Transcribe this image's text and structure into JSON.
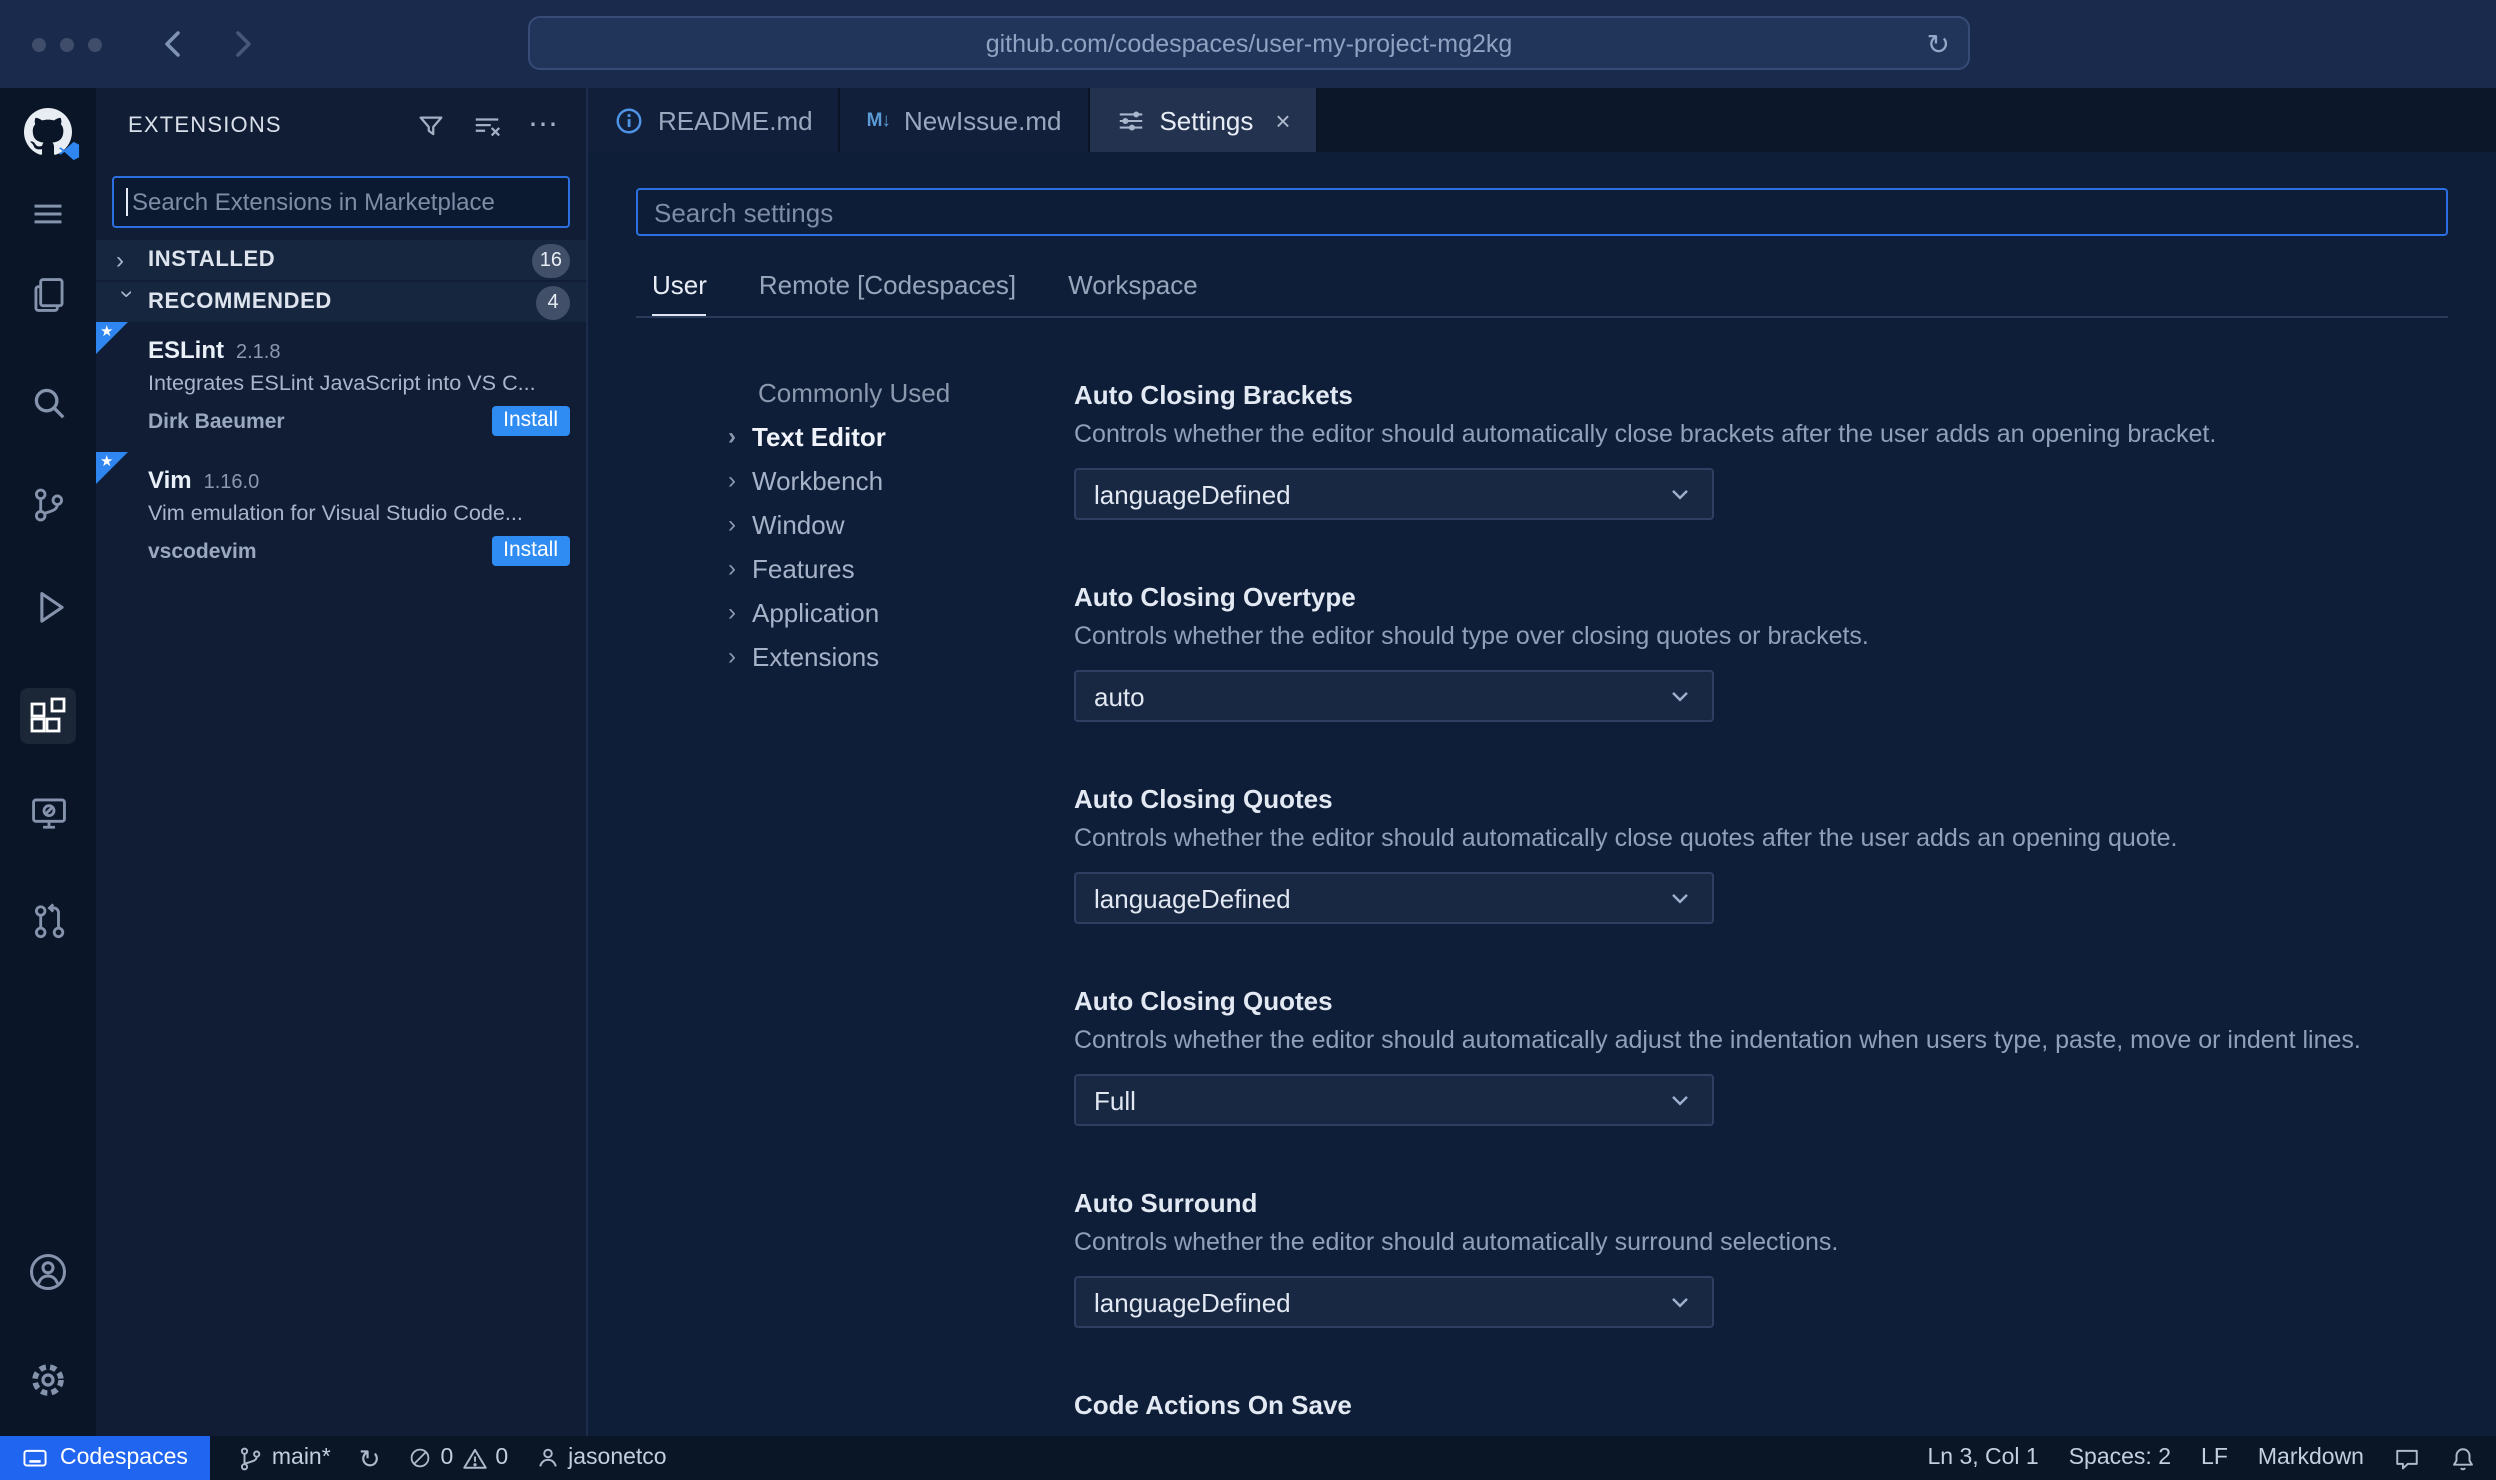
{
  "browser": {
    "url": "github.com/codespaces/user-my-project-mg2kg"
  },
  "sidebar": {
    "title": "EXTENSIONS",
    "search": {
      "placeholder": "Search Extensions in Marketplace"
    },
    "sections": [
      {
        "label": "INSTALLED",
        "badge": "16",
        "expanded": false
      },
      {
        "label": "RECOMMENDED",
        "badge": "4",
        "expanded": true
      }
    ],
    "extensions": [
      {
        "name": "ESLint",
        "version": "2.1.8",
        "description": "Integrates ESLint JavaScript into VS C...",
        "author": "Dirk Baeumer",
        "action_label": "Install"
      },
      {
        "name": "Vim",
        "version": "1.16.0",
        "description": "Vim emulation for Visual Studio Code...",
        "author": "vscodevim",
        "action_label": "Install"
      }
    ]
  },
  "editor": {
    "tabs": [
      {
        "label": "README.md",
        "icon": "info-icon",
        "active": false
      },
      {
        "label": "NewIssue.md",
        "icon": "markdown-icon",
        "active": false
      },
      {
        "label": "Settings",
        "icon": "sliders-icon",
        "active": true,
        "closable": true
      }
    ]
  },
  "settings_page": {
    "search": {
      "placeholder": "Search settings"
    },
    "scopes": [
      {
        "label": "User",
        "active": true
      },
      {
        "label": "Remote [Codespaces]",
        "active": false
      },
      {
        "label": "Workspace",
        "active": false
      }
    ],
    "toc": [
      {
        "label": "Commonly Used",
        "chevron": false,
        "active": false
      },
      {
        "label": "Text Editor",
        "chevron": true,
        "active": true
      },
      {
        "label": "Workbench",
        "chevron": true,
        "active": false
      },
      {
        "label": "Window",
        "chevron": true,
        "active": false
      },
      {
        "label": "Features",
        "chevron": true,
        "active": false
      },
      {
        "label": "Application",
        "chevron": true,
        "active": false
      },
      {
        "label": "Extensions",
        "chevron": true,
        "active": false
      }
    ],
    "items": [
      {
        "title": "Auto Closing Brackets",
        "description": "Controls whether the editor should automatically close brackets after the user adds an opening bracket.",
        "value": "languageDefined",
        "control": "select"
      },
      {
        "title": "Auto Closing Overtype",
        "description": "Controls whether the editor should type over closing quotes or brackets.",
        "value": "auto",
        "control": "select"
      },
      {
        "title": "Auto Closing Quotes",
        "description": "Controls whether the editor should automatically close quotes after the user adds an opening quote.",
        "value": "languageDefined",
        "control": "select"
      },
      {
        "title": "Auto Closing Quotes",
        "description": "Controls whether the editor should automatically adjust the indentation when users type, paste, move or indent lines.",
        "value": "Full",
        "control": "select"
      },
      {
        "title": "Auto Surround",
        "description": "Controls whether the editor should automatically surround selections.",
        "value": "languageDefined",
        "control": "select"
      },
      {
        "title": "Code Actions On Save",
        "description": "",
        "value": "",
        "control": "none"
      }
    ]
  },
  "status_bar": {
    "remote_label": "Codespaces",
    "branch": "main*",
    "errors": "0",
    "warnings": "0",
    "user": "jasonetco",
    "line_col": "Ln 3, Col 1",
    "indentation": "Spaces: 2",
    "eol": "LF",
    "language": "Markdown"
  },
  "icons": {
    "chevron": "›",
    "close": "×",
    "more": "⋯",
    "star": "★",
    "sync": "↻",
    "reload": "↻",
    "markdown_glyph": "M↓"
  },
  "colors": {
    "accent_blue": "#2f8cf3",
    "statusbar_remote_blue": "#2065f0",
    "focus_border": "#2b6fe0",
    "recommend_ribbon_blue": "#2f86f1"
  }
}
